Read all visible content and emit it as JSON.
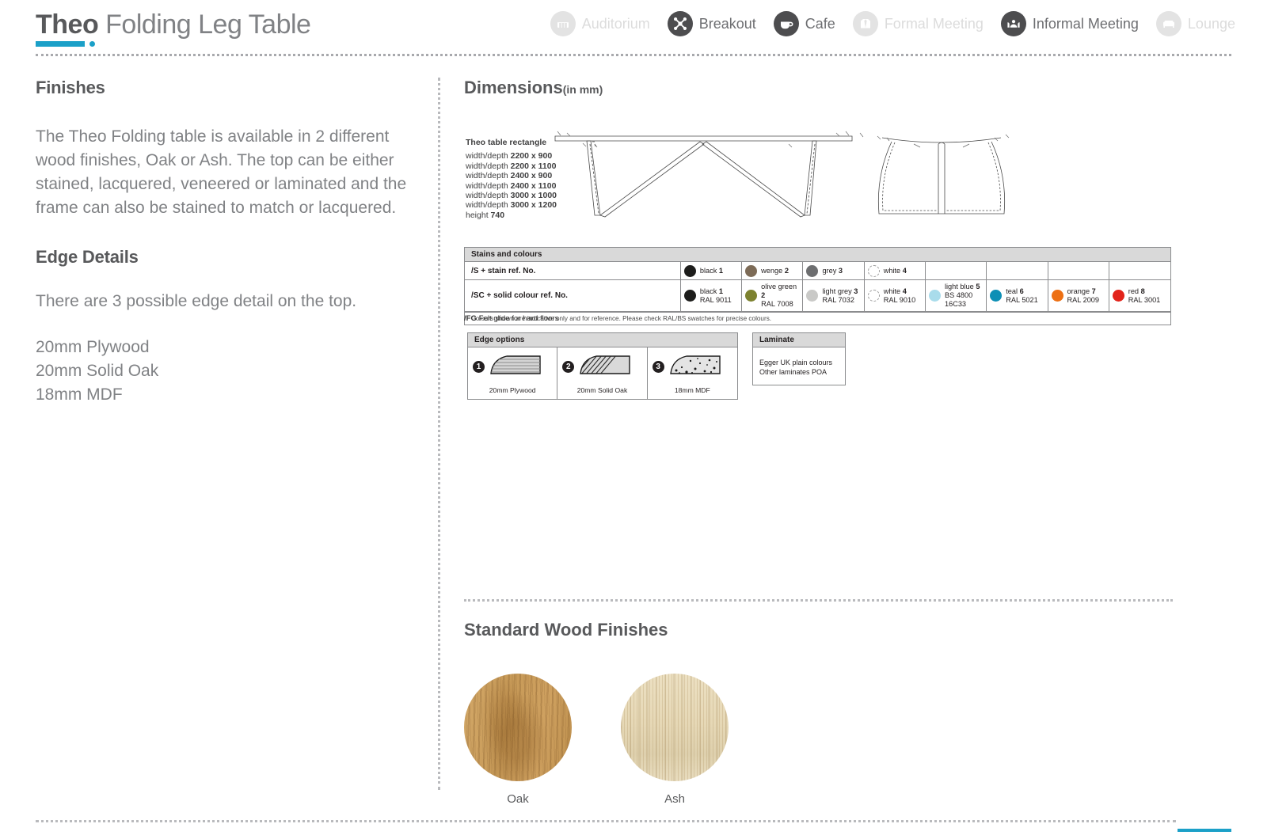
{
  "header": {
    "brand": "Theo",
    "product": " Folding Leg Table",
    "nav": [
      {
        "label": "Auditorium",
        "icon": "auditorium-icon",
        "active": false
      },
      {
        "label": "Breakout",
        "icon": "breakout-icon",
        "active": true
      },
      {
        "label": "Cafe",
        "icon": "cafe-cup-icon",
        "active": true
      },
      {
        "label": "Formal Meeting",
        "icon": "formal-meeting-icon",
        "active": false
      },
      {
        "label": "Informal Meeting",
        "icon": "informal-meeting-icon",
        "active": true
      },
      {
        "label": "Lounge",
        "icon": "lounge-sofa-icon",
        "active": false
      }
    ]
  },
  "left": {
    "finishes_title": "Finishes",
    "finishes_body": "The Theo Folding table is available in 2 different wood finishes, Oak or Ash. The top can be either stained, lacquered, veneered or laminated and the frame can also be stained to match or lacquered.",
    "edge_title": "Edge Details",
    "edge_body": "There are 3 possible edge detail on the top.",
    "edge_list_1": "20mm Plywood",
    "edge_list_2": "20mm Solid Oak",
    "edge_list_3": "18mm MDF"
  },
  "dimensions": {
    "title": "Dimensions",
    "units": "(in mm)",
    "list_title": "Theo table rectangle",
    "rows": [
      {
        "label": "width/depth ",
        "value": "2200 x 900"
      },
      {
        "label": "width/depth ",
        "value": "2200 x 1100"
      },
      {
        "label": "width/depth ",
        "value": "2400 x 900"
      },
      {
        "label": "width/depth ",
        "value": "2400 x 1100"
      },
      {
        "label": "width/depth ",
        "value": "3000 x 1000"
      },
      {
        "label": "width/depth ",
        "value": "3000 x 1200"
      },
      {
        "label": "height ",
        "value": "740"
      }
    ]
  },
  "stains": {
    "heading": "Stains and colours",
    "row_stain_label": "/S + stain ref. No.",
    "row_solid_label": "/SC + solid colour ref. No.",
    "stain_row": [
      {
        "name": "black",
        "num": "1",
        "ral": "",
        "hex": "#1d1d1b",
        "outline": false
      },
      {
        "name": "wenge",
        "num": "2",
        "ral": "",
        "hex": "#7d6b57",
        "outline": false
      },
      {
        "name": "grey",
        "num": "3",
        "ral": "",
        "hex": "#6d6e70",
        "outline": false
      },
      {
        "name": "white",
        "num": "4",
        "ral": "",
        "hex": "#ffffff",
        "outline": true
      },
      {
        "name": "",
        "num": "",
        "ral": "",
        "hex": "",
        "outline": false
      },
      {
        "name": "",
        "num": "",
        "ral": "",
        "hex": "",
        "outline": false
      },
      {
        "name": "",
        "num": "",
        "ral": "",
        "hex": "",
        "outline": false
      },
      {
        "name": "",
        "num": "",
        "ral": "",
        "hex": "",
        "outline": false
      }
    ],
    "solid_row": [
      {
        "name": "black",
        "num": "1",
        "ral": "RAL 9011",
        "hex": "#1d1d1b",
        "outline": false
      },
      {
        "name": "olive green",
        "num": "2",
        "ral": "RAL 7008",
        "hex": "#7d8230",
        "outline": false
      },
      {
        "name": "light grey",
        "num": "3",
        "ral": "RAL 7032",
        "hex": "#c9c9c7",
        "outline": false
      },
      {
        "name": "white",
        "num": "4",
        "ral": "RAL 9010",
        "hex": "#ffffff",
        "outline": true
      },
      {
        "name": "light blue",
        "num": "5",
        "ral": "BS 4800 16C33",
        "hex": "#a9dceb",
        "outline": false
      },
      {
        "name": "teal",
        "num": "6",
        "ral": "RAL 5021",
        "hex": "#0d8fb5",
        "outline": false
      },
      {
        "name": "orange",
        "num": "7",
        "ral": "RAL 2009",
        "hex": "#ed7014",
        "outline": false
      },
      {
        "name": "red",
        "num": "8",
        "ral": "RAL 3001",
        "hex": "#e2231a",
        "outline": false
      }
    ],
    "note": "Colours shown are indicative only and for reference. Please check RAL/BS swatches for precise colours.",
    "fg_code": "/FG",
    "fg_text": " Felt glide for hard floors"
  },
  "edge_options": {
    "heading": "Edge options",
    "items": [
      {
        "num": "1",
        "caption": "20mm Plywood",
        "pattern": "plywood-layers"
      },
      {
        "num": "2",
        "caption": "20mm Solid Oak",
        "pattern": "solid-oak-hatch"
      },
      {
        "num": "3",
        "caption": "18mm MDF",
        "pattern": "mdf-speckle"
      }
    ]
  },
  "laminate": {
    "heading": "Laminate",
    "line1": "Egger UK plain colours",
    "line2": "Other laminates POA"
  },
  "wood": {
    "title": "Standard Wood Finishes",
    "items": [
      {
        "label": "Oak",
        "hex": "#c69a56"
      },
      {
        "label": "Ash",
        "hex": "#e3d5b4"
      }
    ]
  },
  "colors": {
    "accent": "#1ba0c8",
    "heading": "#58595b",
    "body": "#808285"
  }
}
